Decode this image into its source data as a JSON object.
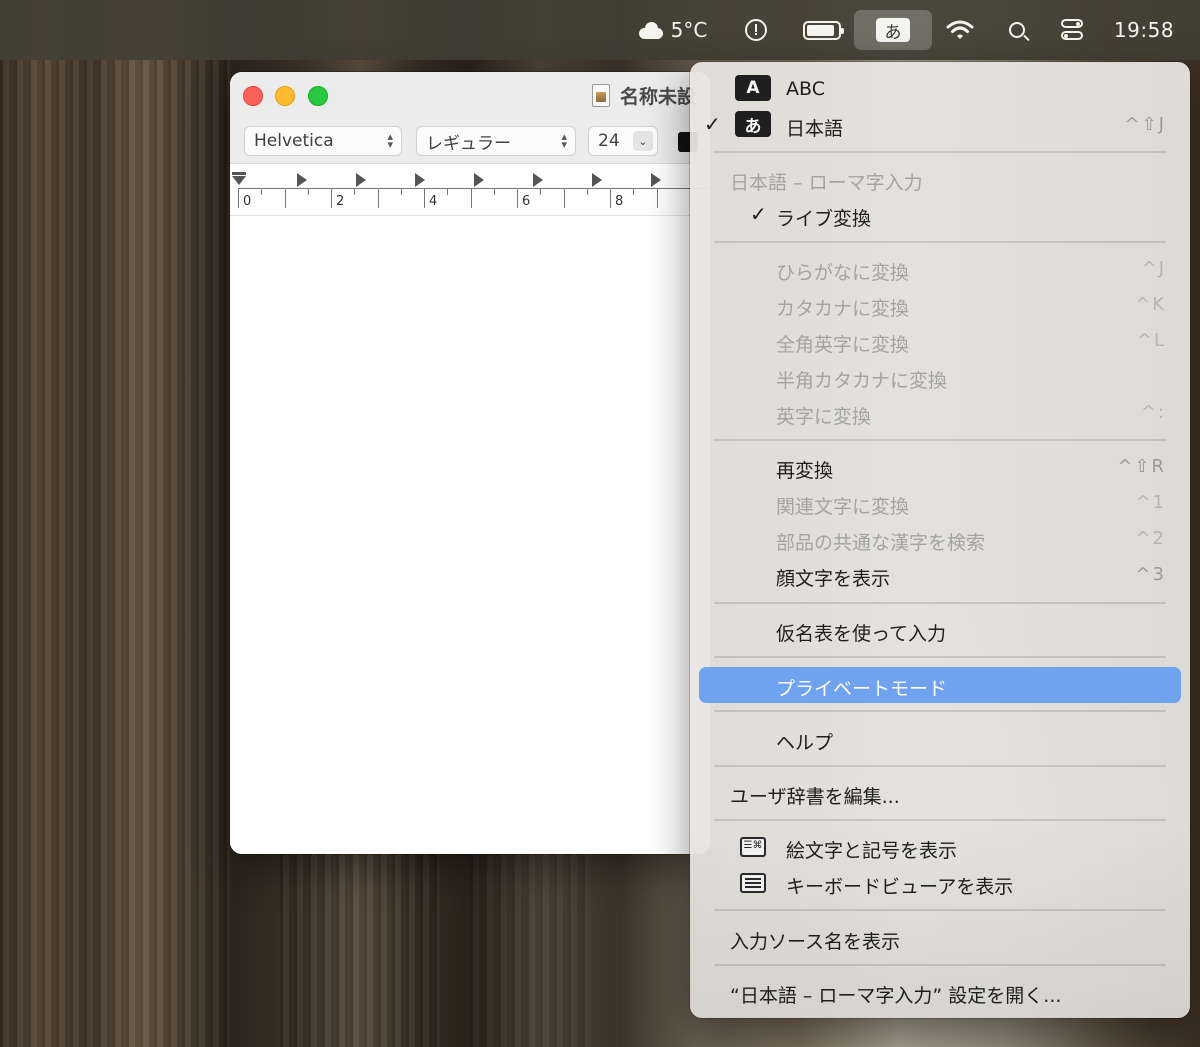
{
  "menubar": {
    "weather": "5°C",
    "input_glyph": "あ",
    "wifi_glyph": "◠",
    "battery_level": 0.9,
    "clock": "19:58"
  },
  "window": {
    "title": "名称未設",
    "font_family": "Helvetica",
    "font_style": "レギュラー",
    "font_size": "24",
    "ruler_labels": [
      "0",
      "2",
      "4",
      "6",
      "8"
    ]
  },
  "menu": {
    "sources": [
      {
        "badge": "A",
        "label": "ABC",
        "shortcut": "",
        "checked": false
      },
      {
        "badge": "あ",
        "label": "日本語",
        "shortcut": "^⇧J",
        "checked": true
      }
    ],
    "section_title": "日本語 – ローマ字入力",
    "live_conversion": "ライブ変換",
    "convert_items": [
      {
        "label": "ひらがなに変換",
        "shortcut": "^J",
        "enabled": false
      },
      {
        "label": "カタカナに変換",
        "shortcut": "^K",
        "enabled": false
      },
      {
        "label": "全角英字に変換",
        "shortcut": "^L",
        "enabled": false
      },
      {
        "label": "半角カタカナに変換",
        "shortcut": "",
        "enabled": false
      },
      {
        "label": "英字に変換",
        "shortcut": "^:",
        "enabled": false
      }
    ],
    "reconvert_items": [
      {
        "label": "再変換",
        "shortcut": "^⇧R",
        "enabled": true
      },
      {
        "label": "関連文字に変換",
        "shortcut": "^1",
        "enabled": false
      },
      {
        "label": "部品の共通な漢字を検索",
        "shortcut": "^2",
        "enabled": false
      },
      {
        "label": "顔文字を表示",
        "shortcut": "^3",
        "enabled": true
      }
    ],
    "kana_table": "仮名表を使って入力",
    "private_mode": "プライベートモード",
    "help": "ヘルプ",
    "edit_dictionary": "ユーザ辞書を編集...",
    "show_emoji": "絵文字と記号を表示",
    "show_keyboard_viewer": "キーボードビューアを表示",
    "show_source_name": "入力ソース名を表示",
    "open_settings": "“日本語 – ローマ字入力” 設定を開く...",
    "highlight_color": "#6fa3f0"
  }
}
